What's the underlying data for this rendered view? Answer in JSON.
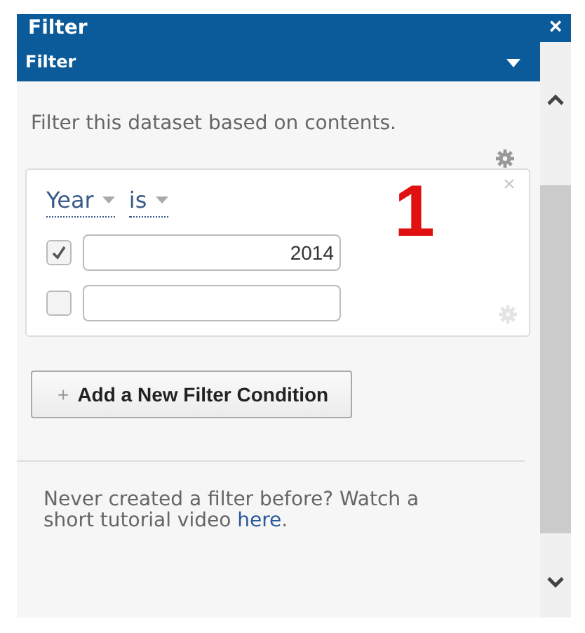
{
  "window": {
    "title": "Filter",
    "close": "×"
  },
  "section": {
    "title": "Filter",
    "expanded": true
  },
  "description": "Filter this dataset based on contents.",
  "condition": {
    "column": "Year",
    "operator": "is",
    "values": [
      {
        "value": "2014",
        "checked": true
      },
      {
        "checked": false
      }
    ]
  },
  "annotation": "1",
  "add_button": {
    "icon": "+",
    "label": "Add a New Filter Condition"
  },
  "help": {
    "text": "Never created a filter before? Watch a short tutorial video ",
    "link": "here",
    "end": "."
  }
}
